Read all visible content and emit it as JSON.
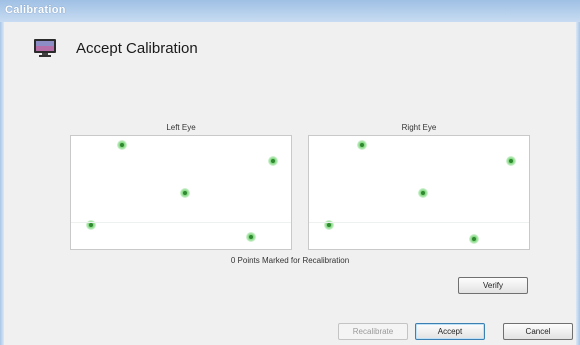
{
  "window": {
    "title": "Calibration"
  },
  "header": {
    "title": "Accept Calibration",
    "icon": "monitor-icon"
  },
  "left_eye": {
    "label": "Left Eye",
    "points": [
      [
        0.23,
        0.08
      ],
      [
        0.92,
        0.22
      ],
      [
        0.52,
        0.5
      ],
      [
        0.09,
        0.79
      ],
      [
        0.82,
        0.89
      ]
    ]
  },
  "right_eye": {
    "label": "Right Eye",
    "points": [
      [
        0.24,
        0.08
      ],
      [
        0.92,
        0.22
      ],
      [
        0.52,
        0.5
      ],
      [
        0.09,
        0.79
      ],
      [
        0.75,
        0.91
      ]
    ]
  },
  "status": {
    "text": "0 Points Marked for Recalibration"
  },
  "buttons": {
    "verify": "Verify",
    "recalibrate": "Recalibrate",
    "accept": "Accept",
    "cancel": "Cancel"
  },
  "colors": {
    "point": "#4fc04f",
    "accent": "#3c7fb1"
  }
}
